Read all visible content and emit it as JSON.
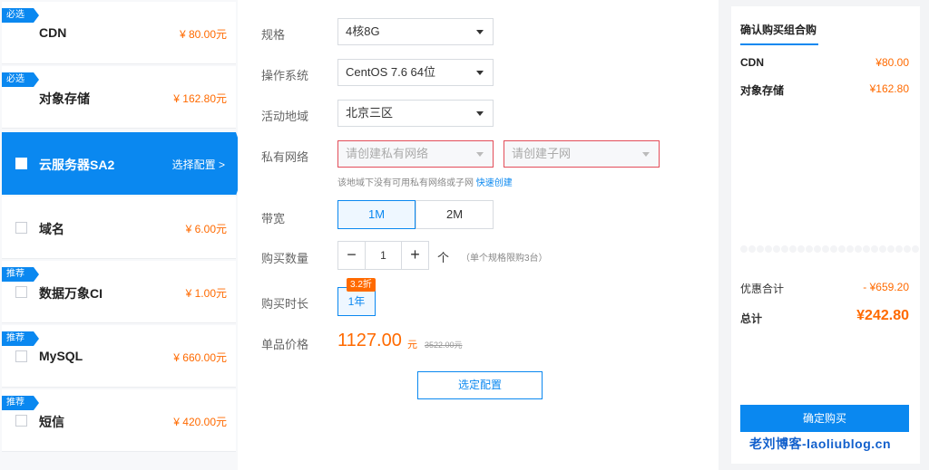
{
  "products": [
    {
      "name": "CDN",
      "price": "¥ 80.00元",
      "tag": "必选",
      "checkbox": false
    },
    {
      "name": "对象存储",
      "price": "¥ 162.80元",
      "tag": "必选",
      "checkbox": false
    },
    {
      "name": "云服务器SA2",
      "action": "选择配置 >",
      "tag": "",
      "checkbox": true,
      "active": true
    },
    {
      "name": "域名",
      "price": "¥ 6.00元",
      "tag": "",
      "checkbox": true
    },
    {
      "name": "数据万象CI",
      "price": "¥ 1.00元",
      "tag": "推荐",
      "checkbox": true
    },
    {
      "name": "MySQL",
      "price": "¥ 660.00元",
      "tag": "推荐",
      "checkbox": true
    },
    {
      "name": "短信",
      "price": "¥ 420.00元",
      "tag": "推荐",
      "checkbox": true
    }
  ],
  "config": {
    "spec_label": "规格",
    "spec_value": "4核8G",
    "os_label": "操作系统",
    "os_value": "CentOS 7.6 64位",
    "region_label": "活动地域",
    "region_value": "北京三区",
    "network_label": "私有网络",
    "vpc_placeholder": "请创建私有网络",
    "subnet_placeholder": "请创建子网",
    "network_hint": "该地域下没有可用私有网络或子网",
    "network_hint_link": "快速创建",
    "bandwidth_label": "带宽",
    "bandwidth_options": [
      "1M",
      "2M"
    ],
    "quantity_label": "购买数量",
    "quantity_value": "1",
    "quantity_minus": "−",
    "quantity_plus": "+",
    "quantity_unit": "个",
    "quantity_limit": "（单个规格限购3台）",
    "duration_label": "购买时长",
    "duration_value": "1年",
    "duration_discount": "3.2折",
    "unit_price_label": "单品价格",
    "unit_price": "1127.00",
    "unit_price_suffix": "元",
    "unit_price_original": "3522.00元",
    "select_button": "选定配置"
  },
  "summary": {
    "title": "确认购买组合购",
    "items": [
      {
        "name": "CDN",
        "price": "¥80.00"
      },
      {
        "name": "对象存储",
        "price": "¥162.80"
      }
    ],
    "discount_label": "优惠合计",
    "discount_value": "- ¥659.20",
    "total_label": "总计",
    "total_value": "¥242.80",
    "buy_button": "确定购买"
  },
  "watermark": "老刘博客-laoliublog.cn",
  "colors": {
    "accent": "#0a88f0",
    "price": "#ff6a00",
    "error": "#e34d59"
  }
}
